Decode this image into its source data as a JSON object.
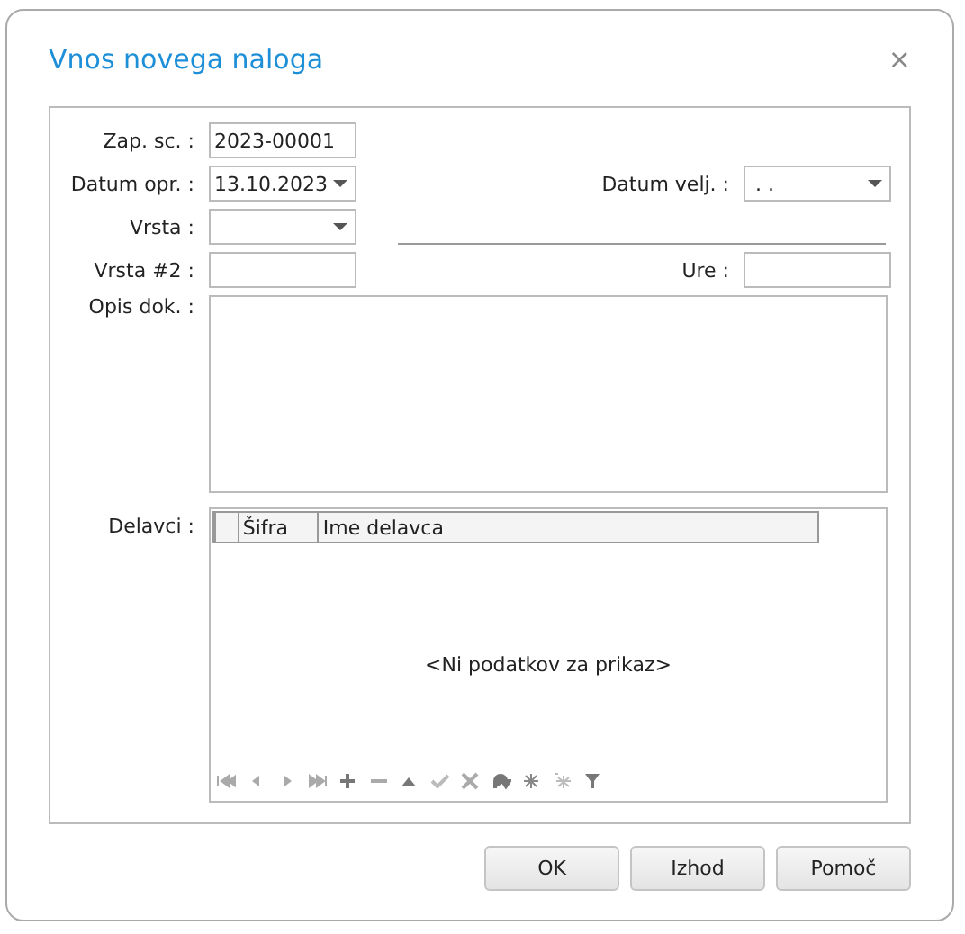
{
  "window": {
    "title": "Vnos novega naloga",
    "close": "×"
  },
  "fields": {
    "zap_sc": {
      "label": "Zap. sc. :",
      "value": "2023-00001"
    },
    "datum_opr": {
      "label": "Datum opr. :",
      "value": "13.10.2023"
    },
    "datum_velj": {
      "label": "Datum velj. :",
      "value": ". ."
    },
    "vrsta": {
      "label": "Vrsta :"
    },
    "vrsta2": {
      "label": "Vrsta #2 :"
    },
    "ure": {
      "label": "Ure :"
    },
    "opis": {
      "label": "Opis dok. :"
    }
  },
  "delavci": {
    "label": "Delavci :",
    "table": {
      "columns": [
        "Šifra",
        "Ime delavca"
      ],
      "empty_text": "<Ni podatkov za prikaz>"
    }
  },
  "buttons": [
    "OK",
    "Izhod",
    "Pomoč"
  ]
}
